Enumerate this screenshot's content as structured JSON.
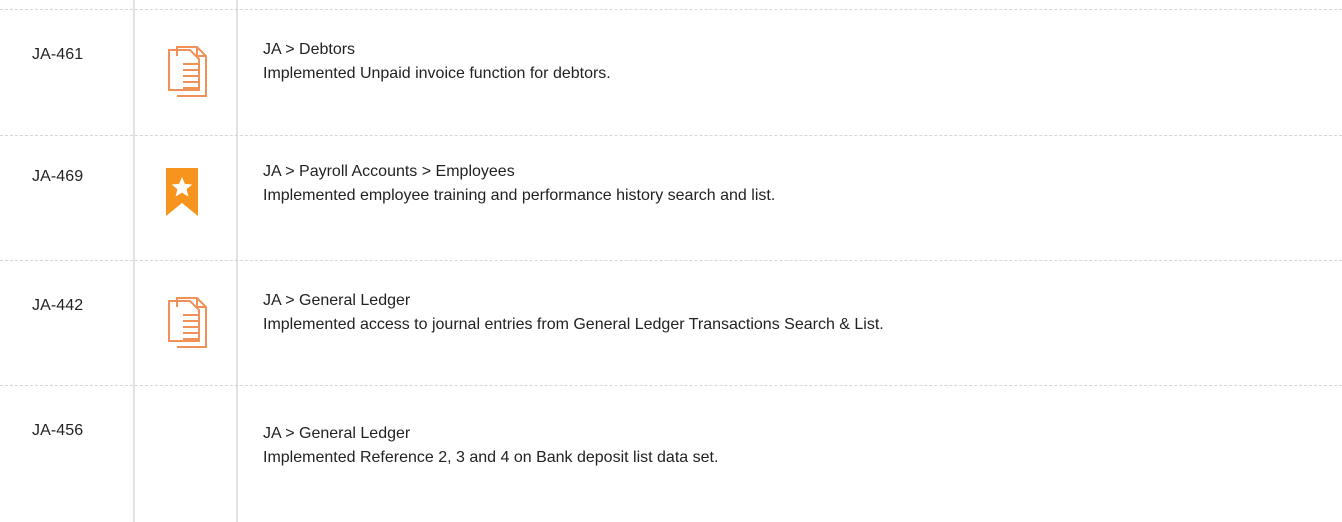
{
  "rows": [
    {
      "id": "JA-461",
      "icon": "document-icon",
      "path": "JA > Debtors",
      "description": "Implemented Unpaid invoice function for debtors."
    },
    {
      "id": "JA-469",
      "icon": "star-bookmark-icon",
      "path": "JA > Payroll Accounts > Employees",
      "description": "Implemented employee training and performance history search and list."
    },
    {
      "id": "JA-442",
      "icon": "document-icon",
      "path": "JA > General Ledger",
      "description": "Implemented access to journal entries from General Ledger Transactions Search & List."
    },
    {
      "id": "JA-456",
      "icon": "",
      "path": "JA > General Ledger",
      "description": "Implemented Reference 2, 3 and 4 on Bank deposit list data set."
    }
  ],
  "colors": {
    "accent_orange": "#f7941d",
    "document_orange": "#f0915a",
    "grid_line": "#e3e3e3",
    "text": "#222222"
  }
}
